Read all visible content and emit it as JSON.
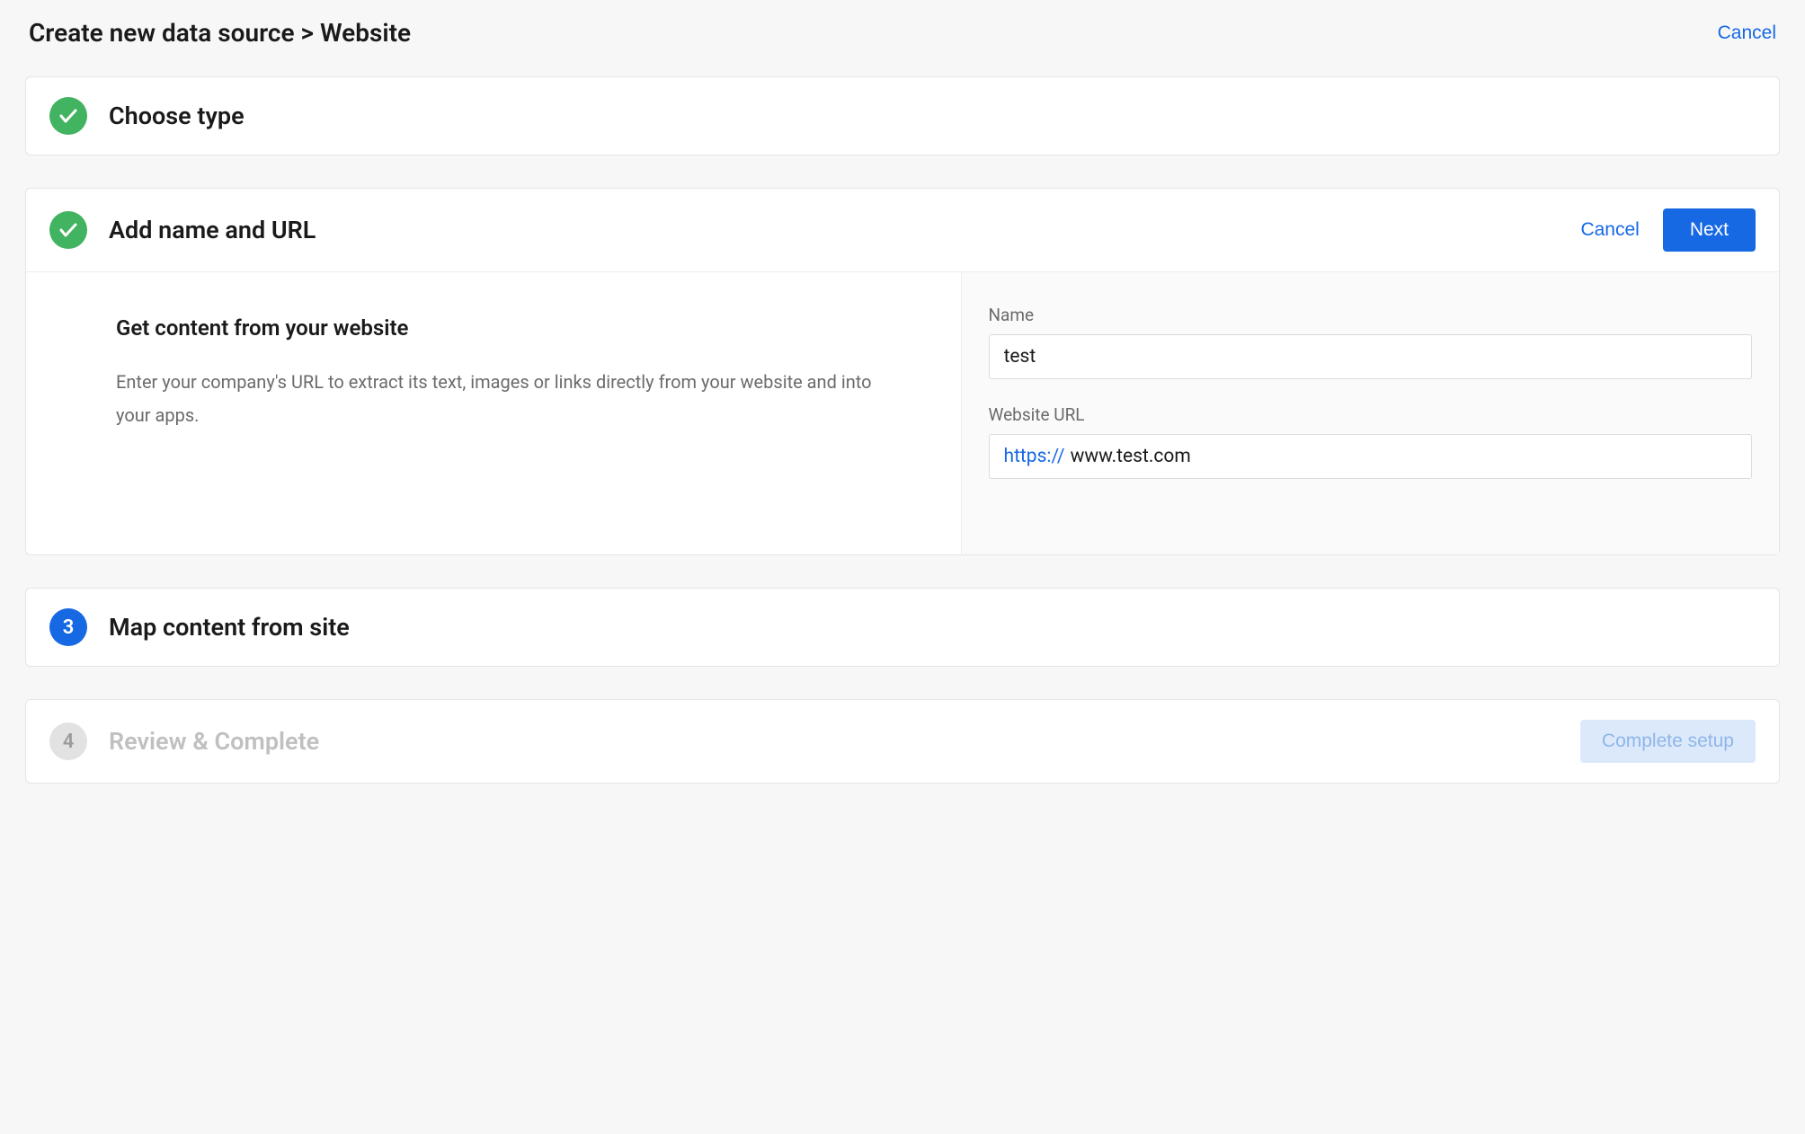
{
  "header": {
    "breadcrumb": "Create new data source > Website",
    "cancel": "Cancel"
  },
  "steps": {
    "s1": {
      "title": "Choose type"
    },
    "s2": {
      "title": "Add name and URL",
      "cancel": "Cancel",
      "next": "Next",
      "left": {
        "heading": "Get content from your website",
        "desc": "Enter your company's URL to extract its text, images or links directly from your website and into your apps."
      },
      "form": {
        "name_label": "Name",
        "name_value": "test",
        "url_label": "Website URL",
        "url_prefix": "https://",
        "url_value": "www.test.com"
      }
    },
    "s3": {
      "number": "3",
      "title": "Map content from site"
    },
    "s4": {
      "number": "4",
      "title": "Review & Complete",
      "button": "Complete setup"
    }
  }
}
